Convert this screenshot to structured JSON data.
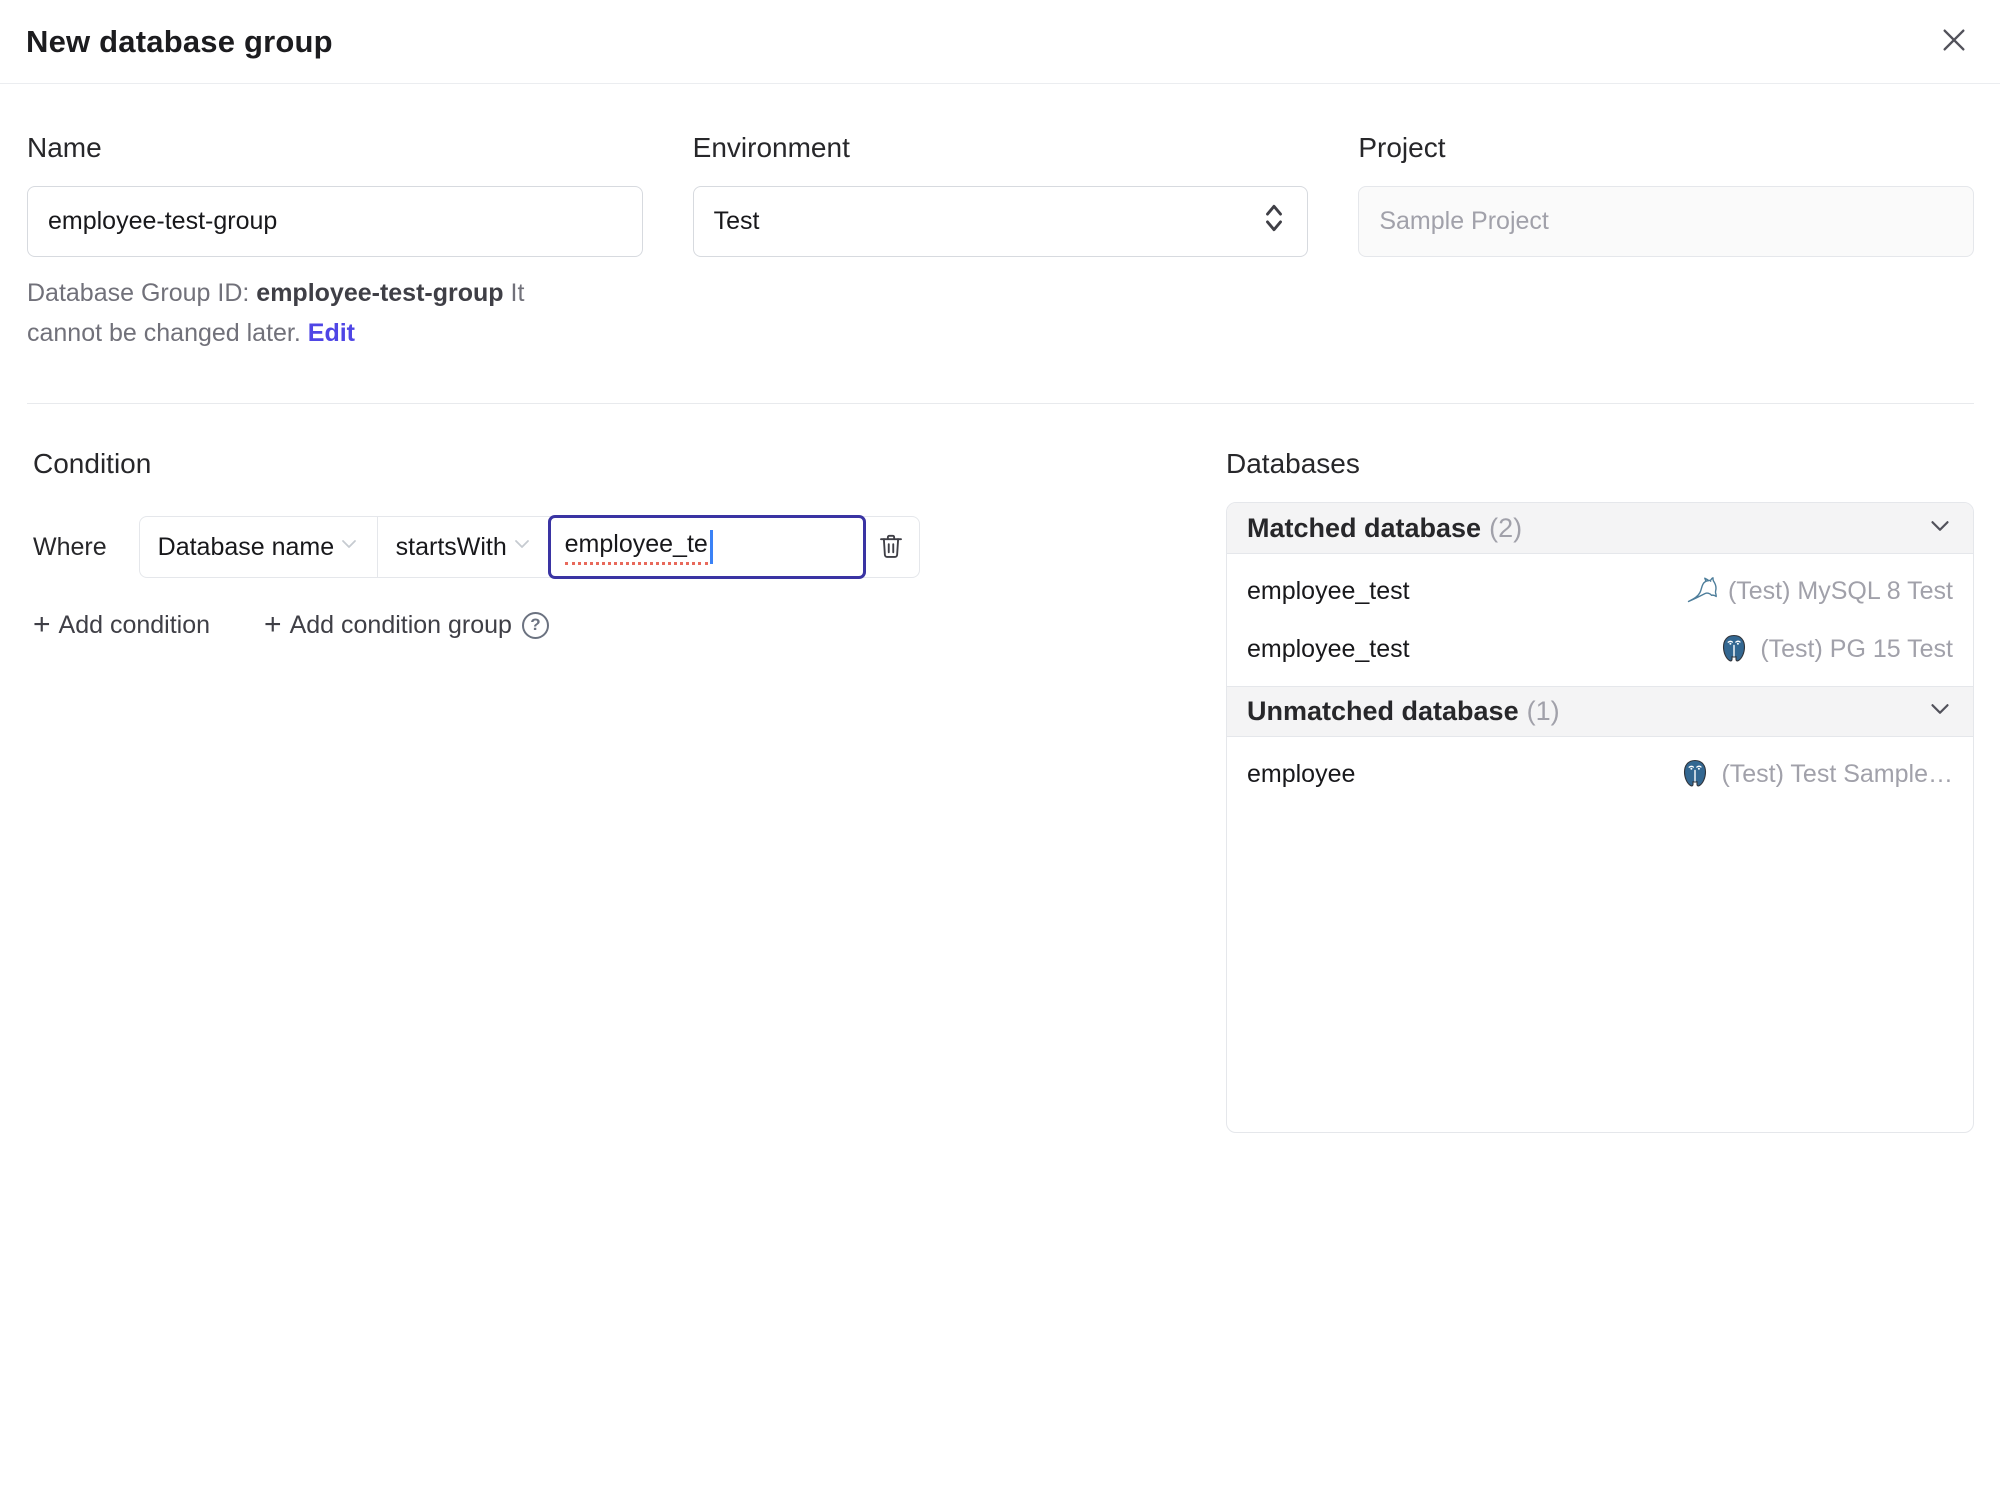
{
  "dialog": {
    "title": "New database group"
  },
  "form": {
    "name": {
      "label": "Name",
      "value": "employee-test-group"
    },
    "environment": {
      "label": "Environment",
      "value": "Test"
    },
    "project": {
      "label": "Project",
      "value": "Sample Project"
    },
    "id_note": {
      "prefix": "Database Group ID: ",
      "id": "employee-test-group",
      "suffix": " It cannot be changed later. ",
      "edit_label": "Edit"
    }
  },
  "condition": {
    "heading": "Condition",
    "where_label": "Where",
    "field": "Database name",
    "operator": "startsWith",
    "value": "employee_te",
    "add_condition_label": "Add condition",
    "add_condition_group_label": "Add condition group"
  },
  "databases": {
    "heading": "Databases",
    "sections": [
      {
        "title": "Matched database",
        "count": "(2)",
        "rows": [
          {
            "name": "employee_test",
            "engine": "mysql",
            "instance": "(Test) MySQL 8 Test"
          },
          {
            "name": "employee_test",
            "engine": "postgresql",
            "instance": "(Test) PG 15 Test"
          }
        ]
      },
      {
        "title": "Unmatched database",
        "count": "(1)",
        "rows": [
          {
            "name": "employee",
            "engine": "postgresql",
            "instance": "(Test) Test Sample…"
          }
        ]
      }
    ]
  },
  "icons": {
    "plus": "+",
    "help": "?"
  },
  "colors": {
    "accent": "#4f46e5",
    "focus_border": "#3a34a3",
    "spellcheck_underline": "#e8695b",
    "mysql_icon": "#4e7e9b",
    "postgresql_icon": "#336791",
    "section_header_bg": "#f4f4f5",
    "muted_text": "#a1a1aa",
    "border": "#e5e7eb"
  }
}
